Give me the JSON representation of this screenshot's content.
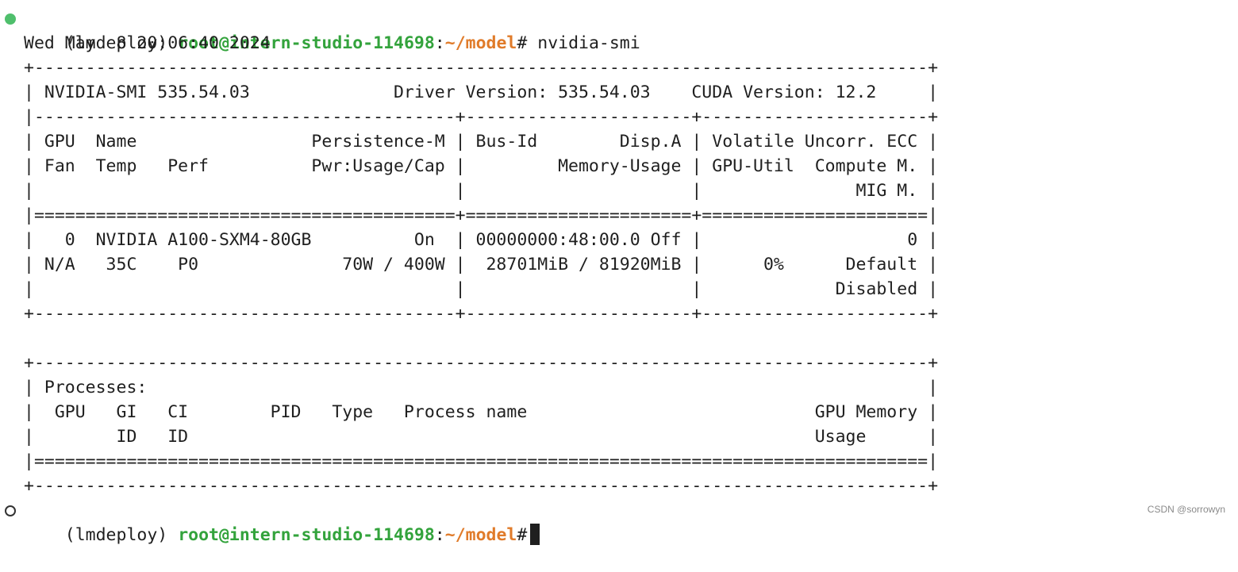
{
  "prompt": {
    "env": "(lmdeploy)",
    "user_host": "root@intern-studio-114698",
    "sep": ":",
    "path": "~/model",
    "symbol": "#",
    "command": " nvidia-smi"
  },
  "output": {
    "date": "Wed May  8 20:06:40 2024",
    "gpu_table": [
      "+---------------------------------------------------------------------------------------+",
      "| NVIDIA-SMI 535.54.03              Driver Version: 535.54.03    CUDA Version: 12.2     |",
      "|-----------------------------------------+----------------------+----------------------+",
      "| GPU  Name                 Persistence-M | Bus-Id        Disp.A | Volatile Uncorr. ECC |",
      "| Fan  Temp   Perf          Pwr:Usage/Cap |         Memory-Usage | GPU-Util  Compute M. |",
      "|                                         |                      |               MIG M. |",
      "|=========================================+======================+======================|",
      "|   0  NVIDIA A100-SXM4-80GB          On  | 00000000:48:00.0 Off |                    0 |",
      "| N/A   35C    P0              70W / 400W |  28701MiB / 81920MiB |      0%      Default |",
      "|                                         |                      |             Disabled |",
      "+-----------------------------------------+----------------------+----------------------+"
    ],
    "processes_table": [
      "+---------------------------------------------------------------------------------------+",
      "| Processes:                                                                            |",
      "|  GPU   GI   CI        PID   Type   Process name                            GPU Memory |",
      "|        ID   ID                                                             Usage      |",
      "|=======================================================================================|",
      "+---------------------------------------------------------------------------------------+"
    ]
  },
  "second_prompt": {
    "env": "(lmdeploy)",
    "user_host": "root@intern-studio-114698",
    "sep": ":",
    "path": "~/model",
    "symbol": "#"
  },
  "watermark": "CSDN @sorrowyn",
  "colors": {
    "user_host": "#33a33c",
    "path": "#e07b2a",
    "success_dot": "#4fbf6c",
    "text": "#1f1f1f"
  }
}
